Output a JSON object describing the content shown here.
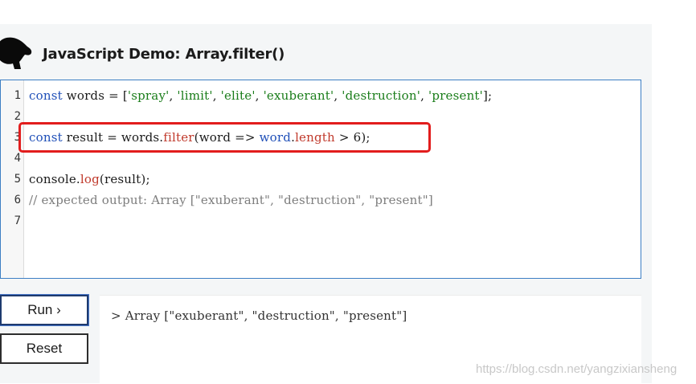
{
  "header": {
    "title": "JavaScript Demo: Array.filter()",
    "logo_icon": "dinosaur-logo-icon"
  },
  "editor": {
    "line_numbers": [
      "1",
      "2",
      "3",
      "4",
      "5",
      "6",
      "7"
    ],
    "line1": {
      "kw": "const",
      "t1": " words = [",
      "s1": "'spray'",
      "c1": ", ",
      "s2": "'limit'",
      "c2": ", ",
      "s3": "'elite'",
      "c3": ", ",
      "s4": "'exuberant'",
      "c4": ", ",
      "s5": "'destruction'",
      "c5": ", ",
      "s6": "'present'",
      "t2": "];"
    },
    "line3": {
      "kw": "const",
      "t1": " result = words.",
      "fn": "filter",
      "t2": "(word => ",
      "word": "word",
      "dot": ".",
      "prop": "length",
      "t3": " > 6);"
    },
    "line5": {
      "t1": "console.",
      "fn": "log",
      "t2": "(result);"
    },
    "line6": {
      "comment": "// expected output: Array [\"exuberant\", \"destruction\", \"present\"]"
    }
  },
  "buttons": {
    "run_label": "Run ›",
    "reset_label": "Reset"
  },
  "output": {
    "text": "> Array [\"exuberant\", \"destruction\", \"present\"]"
  },
  "watermark": "https://blog.csdn.net/yangzixiansheng",
  "colors": {
    "highlight": "#e21d1d",
    "keyword": "#1f4fb8",
    "string": "#1a7d1a",
    "function": "#c0392b"
  }
}
